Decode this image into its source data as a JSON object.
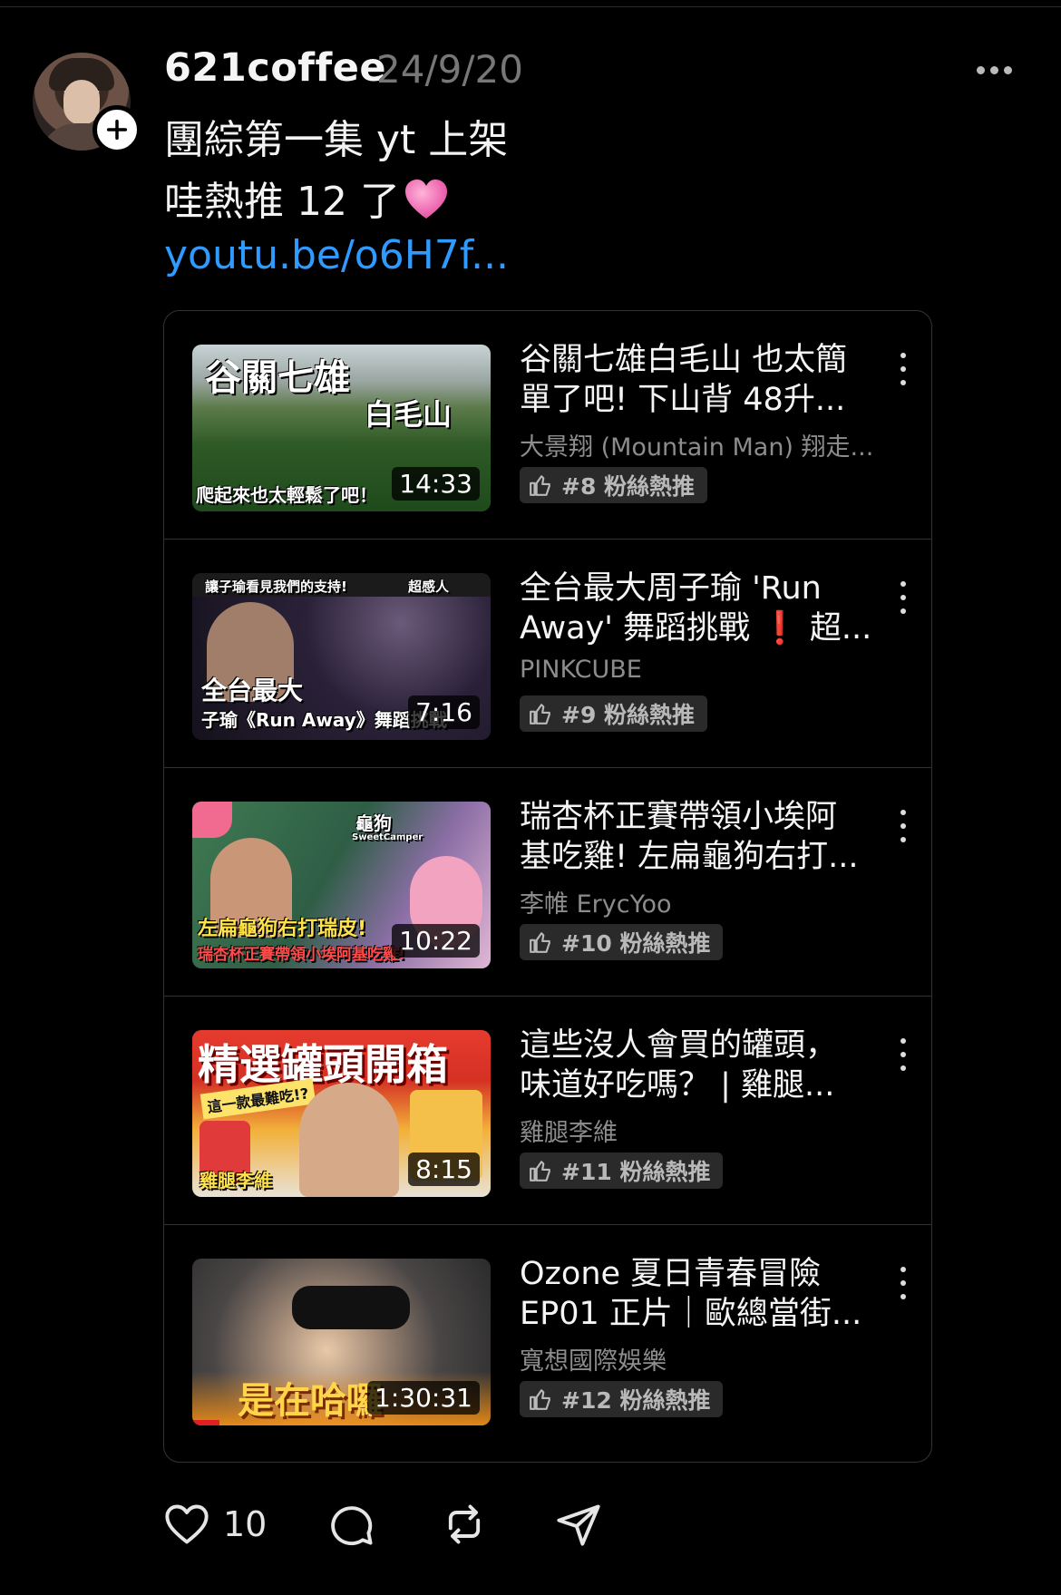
{
  "post": {
    "username": "621coffee",
    "timestamp": "24/9/20",
    "line1": "團綜第一集 yt 上架",
    "line2": "哇熱推 12 了",
    "link": "youtu.be/o6H7f..."
  },
  "videos": [
    {
      "title1": "谷關七雄白毛山 也太簡",
      "title2": "單了吧! 下山背 48升...",
      "channel": "大景翔 (Mountain Man) 翔走...",
      "rank": "#8 粉絲熱推",
      "duration": "14:33",
      "thumb_text1": "谷關七雄",
      "thumb_text2": "白毛山",
      "thumb_text3": "爬起來也太輕鬆了吧！"
    },
    {
      "title1": "全台最大周子瑜 'Run",
      "title2": "Away' 舞蹈挑戰 ❗ 超...",
      "channel": "PINKCUBE",
      "rank": "#9 粉絲熱推",
      "duration": "7:16",
      "thumb_text1": "讓子瑜看見我們的支持!",
      "thumb_text2": "超感人",
      "thumb_text3": "全台最大",
      "thumb_text4": "子瑜《Run Away》舞蹈挑戰"
    },
    {
      "title1": "瑞杏杯正賽帶領小埃阿",
      "title2": "基吃雞! 左扁龜狗右打...",
      "channel": "李帷 ErycYoo",
      "rank": "#10 粉絲熱推",
      "duration": "10:22",
      "thumb_text1": "龜狗",
      "thumb_text2": "SweetCamper",
      "thumb_text3": "左扁龜狗右打瑞皮!",
      "thumb_text4": "瑞杏杯正賽帶領小埃阿基吃雞!"
    },
    {
      "title1": "這些沒人會買的罐頭，",
      "title2": "味道好吃嗎？ | 雞腿...",
      "channel": "雞腿李維",
      "rank": "#11 粉絲熱推",
      "duration": "8:15",
      "thumb_text1": "精選罐頭開箱",
      "thumb_text2": "這一款最難吃!?",
      "thumb_text3": "雞腿李維"
    },
    {
      "title1": "Ozone 夏日青春冒險",
      "title2": "EP01 正片｜歐總當街...",
      "channel": "寬想國際娛樂",
      "rank": "#12 粉絲熱推",
      "duration": "1:30:31",
      "thumb_text1": "是在哈囉"
    }
  ],
  "actions": {
    "like_count": "10"
  },
  "icons": {
    "like": "heart-icon",
    "comment": "comment-icon",
    "repost": "repost-icon",
    "share": "send-icon",
    "rank": "thumbs-up-icon",
    "more": "more-horizontal-icon",
    "kebab": "more-vertical-icon"
  },
  "colors": {
    "background": "#000000",
    "link": "#2f9bff",
    "muted": "#777777"
  }
}
